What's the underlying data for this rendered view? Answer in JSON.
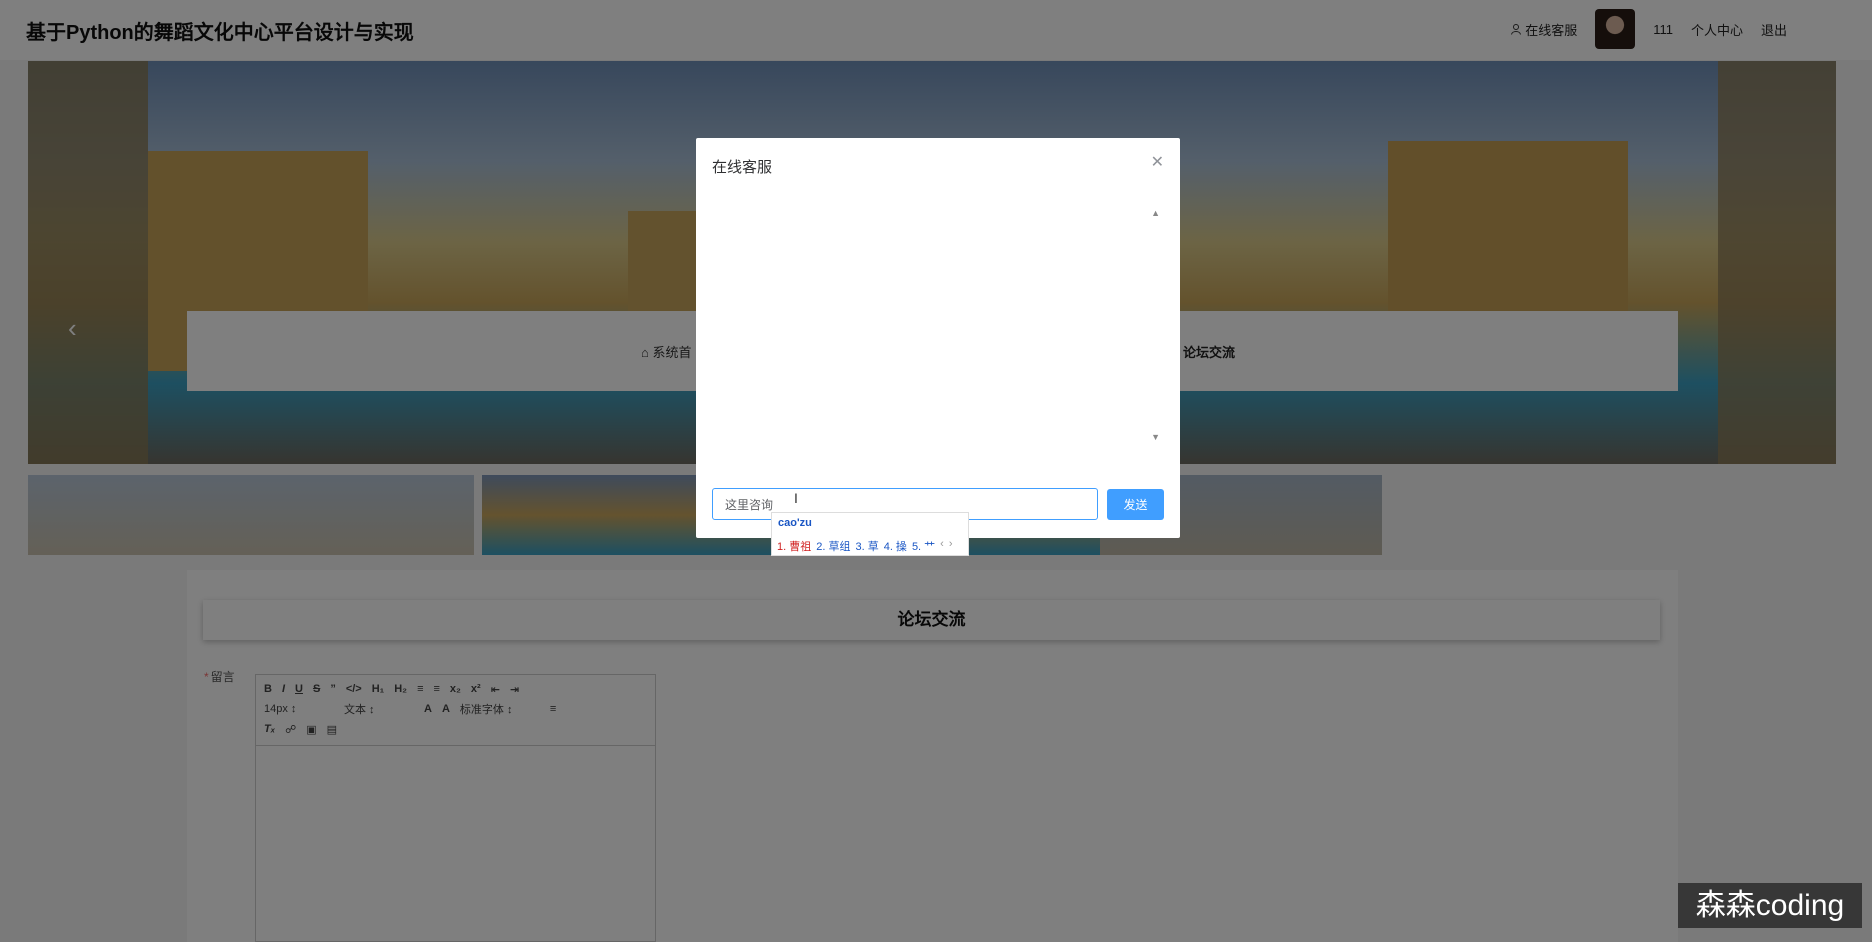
{
  "header": {
    "site_title": "基于Python的舞蹈文化中心平台设计与实现",
    "online_service": "在线客服",
    "username": "111",
    "profile": "个人中心",
    "logout": "退出"
  },
  "banner": {
    "prev_icon": "chevron-left-icon",
    "next_icon": "chevron-right-icon"
  },
  "nav": {
    "home": "系统首",
    "forum": "论坛交流"
  },
  "forum": {
    "heading": "论坛交流",
    "message_label": "留言",
    "toolbar": {
      "font_size": "14px",
      "paragraph": "文本",
      "font_family": "标准字体"
    }
  },
  "dialog": {
    "title": "在线客服",
    "input_placeholder": "这里咨询",
    "send_label": "发送"
  },
  "ime": {
    "pinyin": "cao'zu",
    "candidates": [
      "1. 曹祖",
      "2. 草组",
      "3. 草",
      "4. 操",
      "5. 艹"
    ]
  },
  "watermark": "森森coding"
}
